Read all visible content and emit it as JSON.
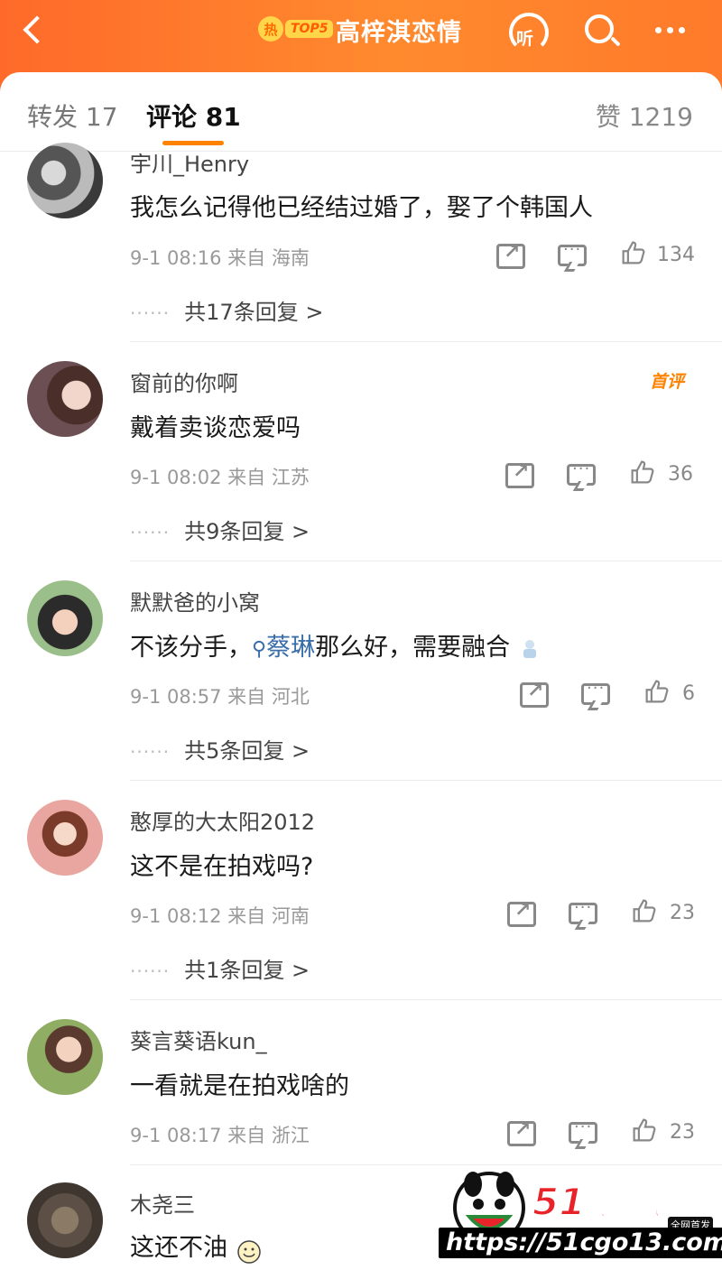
{
  "header": {
    "hot_rank_icon": "热",
    "hot_rank_label": "TOP5",
    "title": "高梓淇恋情",
    "listen_label": "听",
    "back_icon": "back-arrow-icon",
    "search_icon": "search-icon",
    "more_icon": "more-dots-icon",
    "accent_color": "#ff7a2a"
  },
  "tabs": {
    "repost": "转发 17",
    "comment": "评论 81",
    "likes": "赞 1219",
    "active_color": "#ff8200"
  },
  "comments": [
    {
      "name": "宇川_Henry",
      "text": "我怎么记得他已经结过婚了，娶了个韩国人",
      "meta": "9-1 08:16  来自 海南",
      "likes": "134",
      "replies": "共17条回复 >"
    },
    {
      "name": "窗前的你啊",
      "badge": "首评",
      "text": "戴着卖谈恋爱吗",
      "meta": "9-1 08:02  来自 江苏",
      "likes": "36",
      "replies": "共9条回复 >"
    },
    {
      "name": "默默爸的小窝",
      "text_before": "不该分手，",
      "text_link": "蔡琳",
      "text_after": "那么好，需要融合",
      "meta": "9-1 08:57  来自 河北",
      "likes": "6",
      "replies": "共5条回复 >"
    },
    {
      "name": "憨厚的大太阳2012",
      "text": "这不是在拍戏吗?",
      "meta": "9-1 08:12  来自 河南",
      "likes": "23",
      "replies": "共1条回复 >"
    },
    {
      "name": "葵言葵语kun_",
      "text": "一看就是在拍戏啥的",
      "meta": "9-1 08:17  来自 浙江",
      "likes": "23"
    },
    {
      "name": "木尧三",
      "text": "这还不油"
    }
  ],
  "reply_dots": "······",
  "watermark": {
    "brand": "51吃瓜",
    "tag": "全网首发",
    "url": "https://51cgo13.com"
  }
}
